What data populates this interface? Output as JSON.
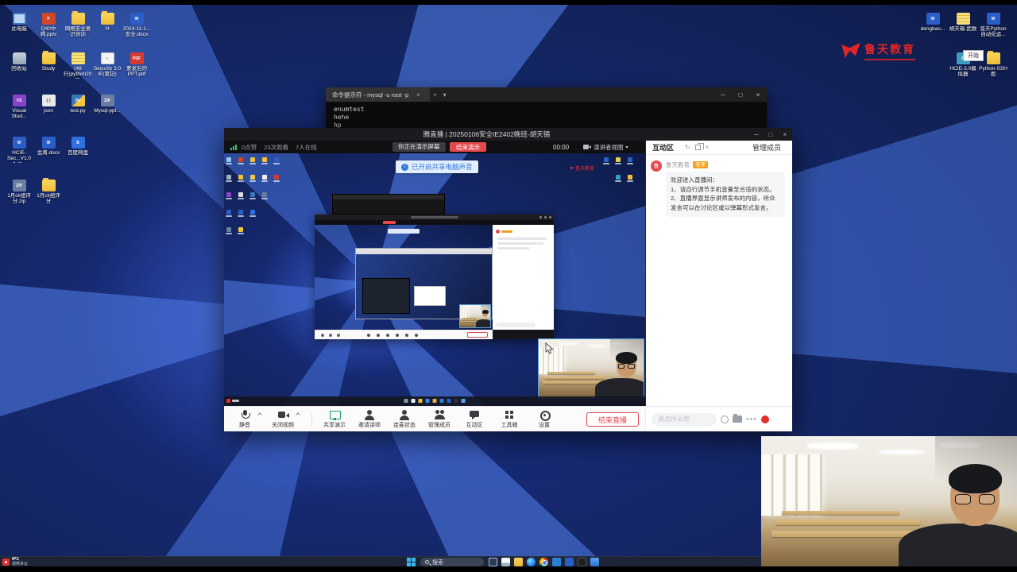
{
  "watermark": {
    "brand": "鲁天教育"
  },
  "desktop": {
    "start_tooltip": "开始",
    "left_icons": [
      {
        "col": 0,
        "row": 0,
        "type": "pc",
        "label": "此电脑"
      },
      {
        "col": 1,
        "row": 0,
        "type": "ppt",
        "label": "Q40中韩.pptx"
      },
      {
        "col": 2,
        "row": 0,
        "type": "folder",
        "label": "网络安全意识培训"
      },
      {
        "col": 3,
        "row": 0,
        "type": "folder",
        "label": "H"
      },
      {
        "col": 4,
        "row": 0,
        "type": "word",
        "label": "2024-11-1...安全.docx"
      },
      {
        "col": 0,
        "row": 1,
        "type": "recycle",
        "label": "回收站"
      },
      {
        "col": 1,
        "row": 1,
        "type": "folder",
        "label": "Study"
      },
      {
        "col": 2,
        "row": 1,
        "type": "notebook",
        "label": "(48行)python202...IE(笔记)"
      },
      {
        "col": 3,
        "row": 1,
        "type": "doc",
        "label": "Security 3.0 IE(笔记)"
      },
      {
        "col": 4,
        "row": 1,
        "type": "pdf",
        "label": "要发后的PPT.pdf"
      },
      {
        "col": 0,
        "row": 2,
        "type": "vs",
        "label": "Visual Stud..."
      },
      {
        "col": 1,
        "row": 2,
        "type": "json",
        "label": "json"
      },
      {
        "col": 2,
        "row": 2,
        "type": "py",
        "label": "test.py"
      },
      {
        "col": 3,
        "row": 2,
        "type": "zip",
        "label": "Mysql-ppt..."
      },
      {
        "col": 0,
        "row": 3,
        "type": "word",
        "label": "HCIE-Sec...V1.0 会议..."
      },
      {
        "col": 1,
        "row": 3,
        "type": "word",
        "label": "会周.docx"
      },
      {
        "col": 2,
        "row": 3,
        "type": "baidu",
        "label": "百度网盘"
      },
      {
        "col": 0,
        "row": 4,
        "type": "zip",
        "label": "1月ck组评分.zip"
      },
      {
        "col": 1,
        "row": 4,
        "type": "folder",
        "label": "1月ck组评分"
      }
    ],
    "right_icons": [
      {
        "col": 0,
        "row": 0,
        "type": "word",
        "label": "dengbao..."
      },
      {
        "col": 1,
        "row": 0,
        "type": "notebook",
        "label": "胡天锡-武数"
      },
      {
        "col": 2,
        "row": 0,
        "type": "word",
        "label": "普天Python自动化运..."
      },
      {
        "col": 1,
        "row": 1,
        "type": "router",
        "label": "HCIE-3.0模拟器"
      },
      {
        "col": 2,
        "row": 1,
        "type": "folder",
        "label": "Python-SSH面"
      }
    ]
  },
  "terminal": {
    "tab_title": "命令提示符 - mysql  -u root -p",
    "lines": [
      "enumtest",
      "hehe",
      "hp"
    ]
  },
  "stream": {
    "title": "腾直播 | 20250106安全IE2402晚班-胡天锡",
    "stats": {
      "likes": "0点赞",
      "views": "23次观看",
      "online": "7人在线"
    },
    "presenting": "你正在演示屏幕",
    "end_present": "结束演示",
    "timer": "00:00",
    "view_mode": "演讲者视图",
    "audio_notice": "已开启共享电脑声音",
    "toolbar": [
      {
        "label": "静音",
        "icon": "mic",
        "chevron": true
      },
      {
        "label": "关闭视频",
        "icon": "camera",
        "chevron": true
      },
      {
        "label": "共享演示",
        "icon": "share"
      },
      {
        "label": "邀请讲师",
        "icon": "invite"
      },
      {
        "label": "连麦状态",
        "icon": "micstat"
      },
      {
        "label": "管理成员",
        "icon": "members"
      },
      {
        "label": "互动区",
        "icon": "chat"
      },
      {
        "label": "工具箱",
        "icon": "toolbox"
      },
      {
        "label": "设置",
        "icon": "gear"
      }
    ],
    "end_live": "结束直播",
    "panel": {
      "tab_chat": "互动区",
      "tab_members": "管理成员",
      "author": "鲁天教育",
      "badge": "老师",
      "message": "欢迎进入直播间：\n1、请自行调节手机音量至合适的状态。\n2、直播界面显示讲师发布的内容，听众发言可以在讨论区或以弹幕形式发言。",
      "input_placeholder": "说点什么吧"
    }
  },
  "taskbar": {
    "corner_top": "IPC",
    "corner_bottom": "视频多云",
    "search": "搜索",
    "icons": [
      "task-view",
      "sail",
      "file-explorer",
      "edge",
      "chrome",
      "vscode",
      "word",
      "terminal",
      "mail"
    ]
  }
}
